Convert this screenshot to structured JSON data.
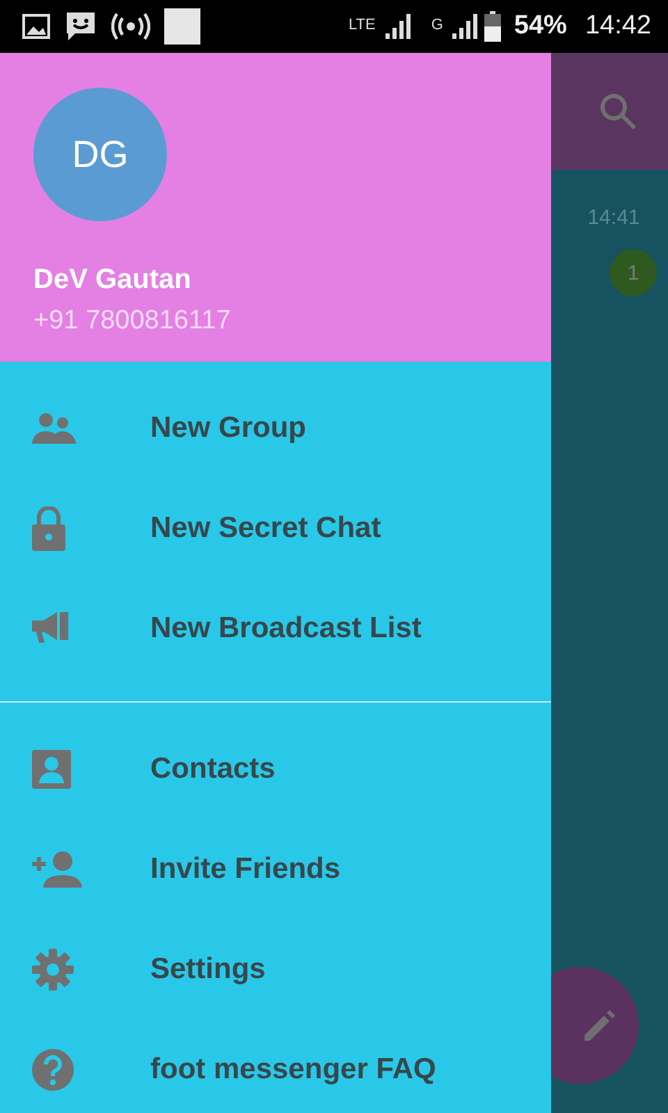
{
  "status_bar": {
    "networks": [
      {
        "label": "LTE"
      },
      {
        "label": "G"
      }
    ],
    "battery": "54%",
    "time": "14:42"
  },
  "background": {
    "chat_time": "14:41",
    "unread_count": "1"
  },
  "drawer": {
    "profile": {
      "initials": "DG",
      "name": "DeV Gautan",
      "phone": "+91 7800816117"
    },
    "sections": [
      [
        {
          "kind": "group",
          "label": "New Group"
        },
        {
          "kind": "lock",
          "label": "New Secret Chat"
        },
        {
          "kind": "broadcast",
          "label": "New Broadcast List"
        }
      ],
      [
        {
          "kind": "contacts",
          "label": "Contacts"
        },
        {
          "kind": "invite",
          "label": "Invite Friends"
        },
        {
          "kind": "settings",
          "label": "Settings"
        },
        {
          "kind": "help",
          "label": "foot messenger FAQ"
        }
      ]
    ]
  }
}
